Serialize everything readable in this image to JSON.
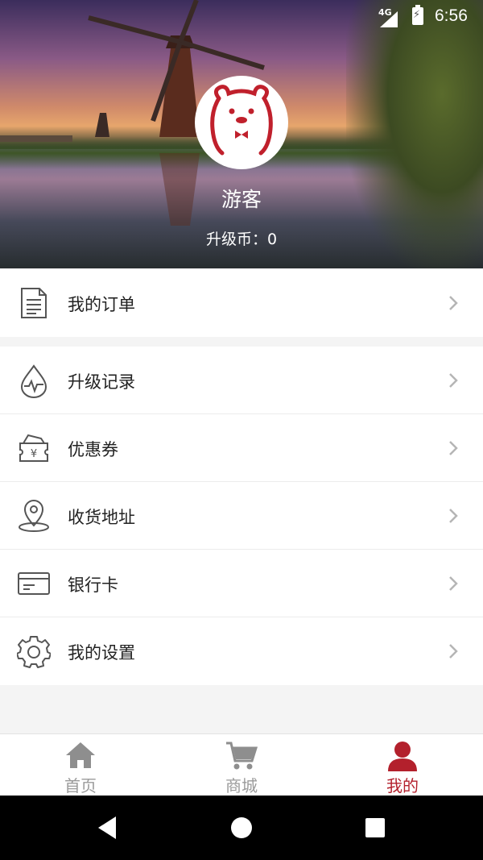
{
  "status_bar": {
    "network": "4G",
    "time": "6:56"
  },
  "profile": {
    "name": "游客",
    "coins_label": "升级币：",
    "coins_value": "0",
    "avatar_icon": "bear-avatar-icon"
  },
  "menu": {
    "orders": {
      "label": "我的订单",
      "icon": "document-icon"
    },
    "items": [
      {
        "label": "升级记录",
        "icon": "pulse-drop-icon"
      },
      {
        "label": "优惠券",
        "icon": "coupon-yen-icon"
      },
      {
        "label": "收货地址",
        "icon": "location-pin-icon"
      },
      {
        "label": "银行卡",
        "icon": "bank-card-icon"
      },
      {
        "label": "我的设置",
        "icon": "gear-icon"
      }
    ]
  },
  "tabs": [
    {
      "label": "首页",
      "icon": "home-icon",
      "active": false
    },
    {
      "label": "商城",
      "icon": "cart-icon",
      "active": false
    },
    {
      "label": "我的",
      "icon": "user-icon",
      "active": true
    }
  ],
  "colors": {
    "accent": "#b3202c",
    "inactive": "#9a9a9a",
    "icon_stroke": "#555555"
  }
}
